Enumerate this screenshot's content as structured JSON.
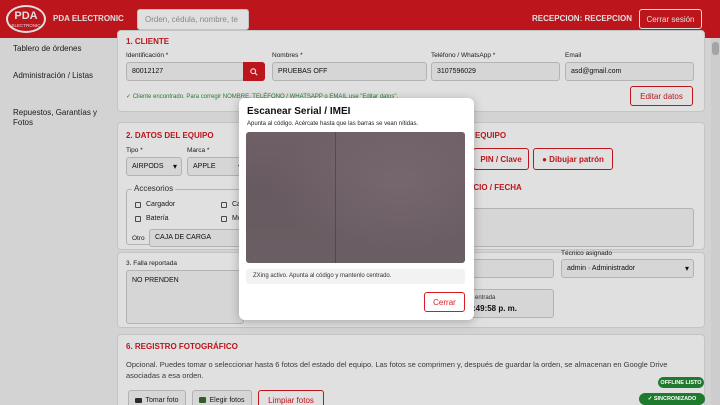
{
  "header": {
    "logo_text_top": "PDA",
    "logo_text_bottom": "ELECTRONIC",
    "brand": "PDA ELECTRONIC",
    "search_placeholder": "Orden, cédula, nombre, te",
    "reception": "RECEPCION: RECEPCION",
    "logout": "Cerrar sesión"
  },
  "sidebar": {
    "items": [
      {
        "label": "Tablero de órdenes"
      },
      {
        "label": "Administración / Listas"
      },
      {
        "label": "Repuestos, Garantías y Fotos"
      }
    ]
  },
  "cliente": {
    "title": "1. CLIENTE",
    "id_label": "Identificación *",
    "id_value": "80012127",
    "name_label": "Nombres *",
    "name_value": "PRUEBAS OFF",
    "phone_label": "Teléfono / WhatsApp *",
    "phone_value": "3107596029",
    "email_label": "Email",
    "email_value": "asd@gmail.com",
    "found_msg": "✓ Cliente encontrado. Para corregir NOMBRE, TELÉFONO / WHATSAPP o EMAIL use \"Editar datos\".",
    "edit_button": "Editar datos"
  },
  "equipo": {
    "title": "2. DATOS DEL EQUIPO",
    "tipo_label": "Tipo *",
    "tipo_value": "AIRPODS",
    "marca_label": "Marca *",
    "marca_value": "APPLE",
    "accesorios_title": "Accesorios",
    "acc_cargador": "Cargador",
    "acc_ca": "Ca",
    "acc_bateria": "Batería",
    "acc_mo": "Mo",
    "otro_label": "Otro",
    "otro_value": "CAJA DE CARGA"
  },
  "falla": {
    "label": "3. Falla reportada",
    "value": "NO PRENDEN"
  },
  "right_panel": {
    "title_fragment": "L EQUIPO",
    "pin_button": "PIN / Clave",
    "pattern_button": "● Dibujar patrón",
    "precio_fragment": "ECIO / FECHA",
    "tecnico_label": "Técnico asignado",
    "tecnico_value": "admin · Administrador",
    "entrada_label": "entrada",
    "entrada_time": ":49:58 p. m."
  },
  "fotos": {
    "title": "6. REGISTRO FOTOGRÁFICO",
    "desc": "Opcional. Puedes tomar o seleccionar hasta 6 fotos del estado del equipo. Las fotos se comprimen y, después de guardar la orden, se almacenan en Google Drive asociadas a esa orden.",
    "take_photo": "Tomar foto",
    "choose_photos": "Elegir fotos",
    "clear_photos": "Limpiar fotos"
  },
  "modal": {
    "title": "Escanear Serial / IMEI",
    "subtitle": "Apunta al código. Acércate hasta que las barras se vean nítidas.",
    "status": "ZXing activo. Apunta al código y mantenlo centrado.",
    "close": "Cerrar"
  },
  "badges": {
    "offline": "OFFLINE LISTO",
    "sync": "✓ SINCRONIZADO"
  },
  "colors": {
    "brand_red": "#d71920",
    "success_green": "#1f7a2e"
  }
}
